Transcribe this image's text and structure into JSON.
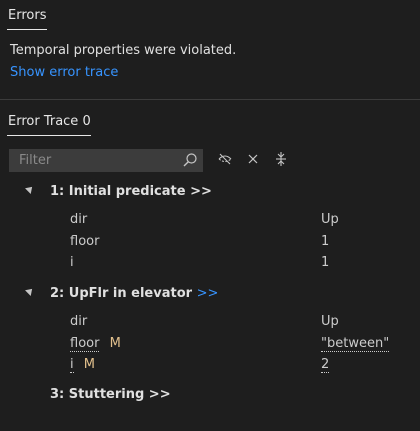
{
  "errors_section": {
    "tab_label": "Errors",
    "message": "Temporal properties were violated.",
    "show_trace_link": "Show error trace"
  },
  "trace_section": {
    "tab_label": "Error Trace 0",
    "filter_placeholder": "Filter",
    "icons": [
      "search-icon",
      "eye-off-icon",
      "close-icon",
      "collapse-all-icon"
    ]
  },
  "states": [
    {
      "label": "1: Initial predicate >>",
      "link": "",
      "vars": [
        {
          "name": "dir",
          "value": "Up",
          "modified": false
        },
        {
          "name": "floor",
          "value": "1",
          "modified": false
        },
        {
          "name": "i",
          "value": "1",
          "modified": false
        }
      ]
    },
    {
      "label": "2: UpFlr in elevator",
      "link": ">>",
      "vars": [
        {
          "name": "dir",
          "value": "Up",
          "modified": false,
          "badge": ""
        },
        {
          "name": "floor",
          "value": "\"between\"",
          "modified": true,
          "badge": "M"
        },
        {
          "name": "i",
          "value": "2",
          "modified": true,
          "badge": "M"
        }
      ]
    },
    {
      "label": "3: Stuttering >>",
      "link": "",
      "vars": []
    }
  ],
  "colors": {
    "background": "#1e1e1e",
    "link": "#3794ff",
    "modified_badge": "#e2c08d"
  }
}
